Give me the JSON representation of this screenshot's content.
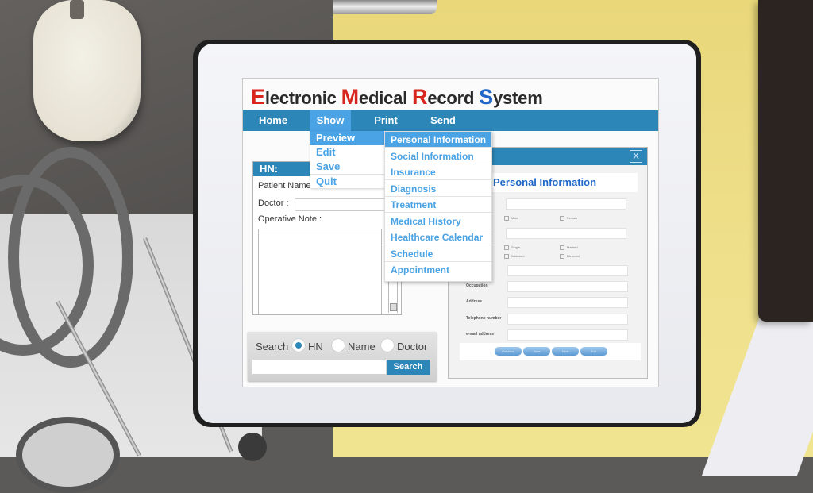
{
  "app": {
    "title_parts": [
      {
        "initial": "E",
        "rest": "lectronic "
      },
      {
        "initial": "M",
        "rest": "edical "
      },
      {
        "initial": "R",
        "rest": "ecord "
      },
      {
        "initial": "S",
        "rest": "ystem"
      }
    ]
  },
  "colors": {
    "nav_bar": "#2d86b8",
    "nav_active": "#4aa3e4",
    "title_red": "#d9261c",
    "title_blue": "#1f67c8",
    "menu_text": "#4aa3e4"
  },
  "navbar": {
    "items": [
      "Home",
      "Show",
      "Print",
      "Send"
    ],
    "active": "Show"
  },
  "show_menu": {
    "items": [
      "Preview",
      "Edit",
      "Save",
      "Quit"
    ],
    "active": "Preview"
  },
  "preview_submenu": {
    "items": [
      "Personal Information",
      "Social Information",
      "Insurance",
      "Diagnosis",
      "Treatment",
      "Medical History",
      "Healthcare Calendar",
      "Schedule",
      "Appointment"
    ],
    "active": "Personal Information"
  },
  "hn_panel": {
    "header": "HN:",
    "patient_name_label": "Patient Name :",
    "doctor_label": "Doctor :",
    "operative_note_label": "Operative Note :"
  },
  "search_panel": {
    "label": "Search",
    "options": [
      "HN",
      "Name",
      "Doctor"
    ],
    "selected": "HN",
    "input_value": "",
    "button": "Search"
  },
  "dialog": {
    "close": "X",
    "title": "Personal Information",
    "gender_options": [
      "Male",
      "Female"
    ],
    "marital_options": [
      "Single",
      "Married",
      "Widowed",
      "Divorced"
    ],
    "fields": [
      "Occupation",
      "Address",
      "Telephone number",
      "e-mail address"
    ],
    "buttons": [
      "Previous",
      "Save",
      "Next",
      "Exit"
    ]
  }
}
